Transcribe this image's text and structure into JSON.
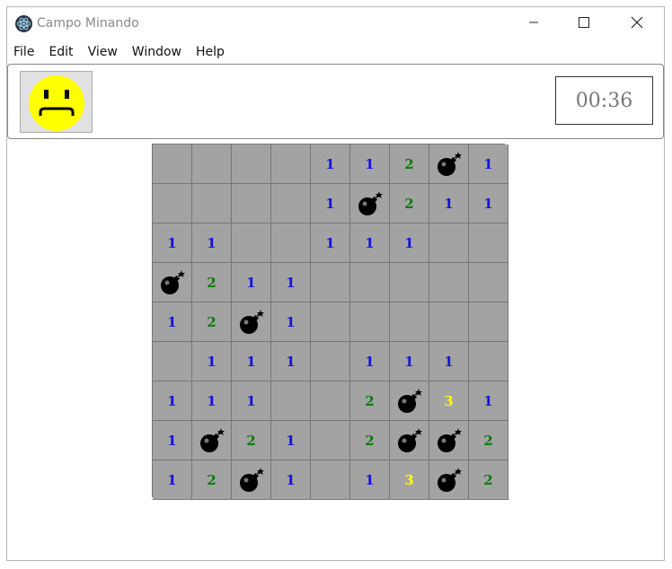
{
  "window": {
    "title": "Campo Minando"
  },
  "menu": [
    "File",
    "Edit",
    "View",
    "Window",
    "Help"
  ],
  "header": {
    "face": "sad-face",
    "timer": "00:36"
  },
  "board": {
    "rows": [
      [
        "",
        "",
        "",
        "",
        "1",
        "1",
        "2",
        "*",
        "1"
      ],
      [
        "",
        "",
        "",
        "",
        "1",
        "*",
        "2",
        "1",
        "1"
      ],
      [
        "1",
        "1",
        "",
        "",
        "1",
        "1",
        "1",
        "",
        ""
      ],
      [
        "*",
        "2",
        "1",
        "1",
        "",
        "",
        "",
        "",
        ""
      ],
      [
        "1",
        "2",
        "*",
        "1",
        "",
        "",
        "",
        "",
        ""
      ],
      [
        "",
        "1",
        "1",
        "1",
        "",
        "1",
        "1",
        "1",
        ""
      ],
      [
        "1",
        "1",
        "1",
        "",
        "",
        "2",
        "*",
        "3",
        "1"
      ],
      [
        "1",
        "*",
        "2",
        "1",
        "",
        "2",
        "*",
        "*",
        "2"
      ],
      [
        "1",
        "2",
        "*",
        "1",
        "",
        "1",
        "3",
        "*",
        "2"
      ]
    ],
    "colors": {
      "1": "#1212e0",
      "2": "#0a7a0a",
      "3": "#ffff00",
      "cell": "#a3a3a3"
    }
  }
}
